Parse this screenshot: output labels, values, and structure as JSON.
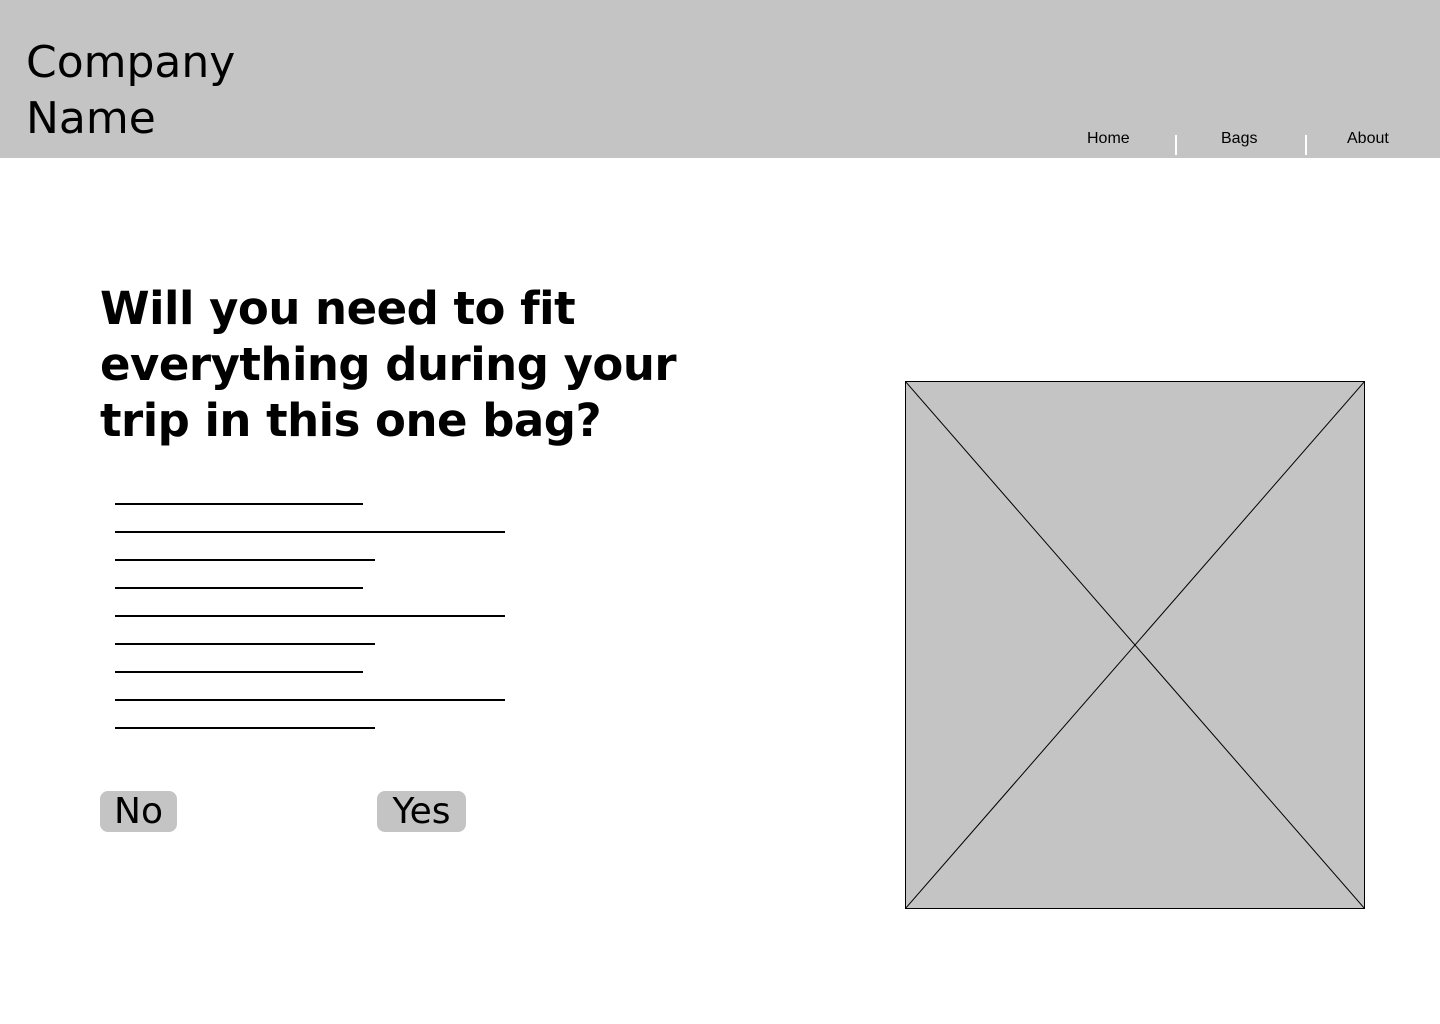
{
  "header": {
    "company_name": "Company Name",
    "nav": [
      {
        "label": "Home"
      },
      {
        "label": "Bags"
      },
      {
        "label": "About"
      }
    ]
  },
  "main": {
    "question": "Will you need to fit everything during your trip in this one bag?",
    "buttons": {
      "no_label": "No",
      "yes_label": "Yes"
    }
  },
  "colors": {
    "header_bg": "#c4c4c4",
    "button_bg": "#c4c4c4",
    "placeholder_bg": "#c4c4c4",
    "text": "#000000"
  }
}
